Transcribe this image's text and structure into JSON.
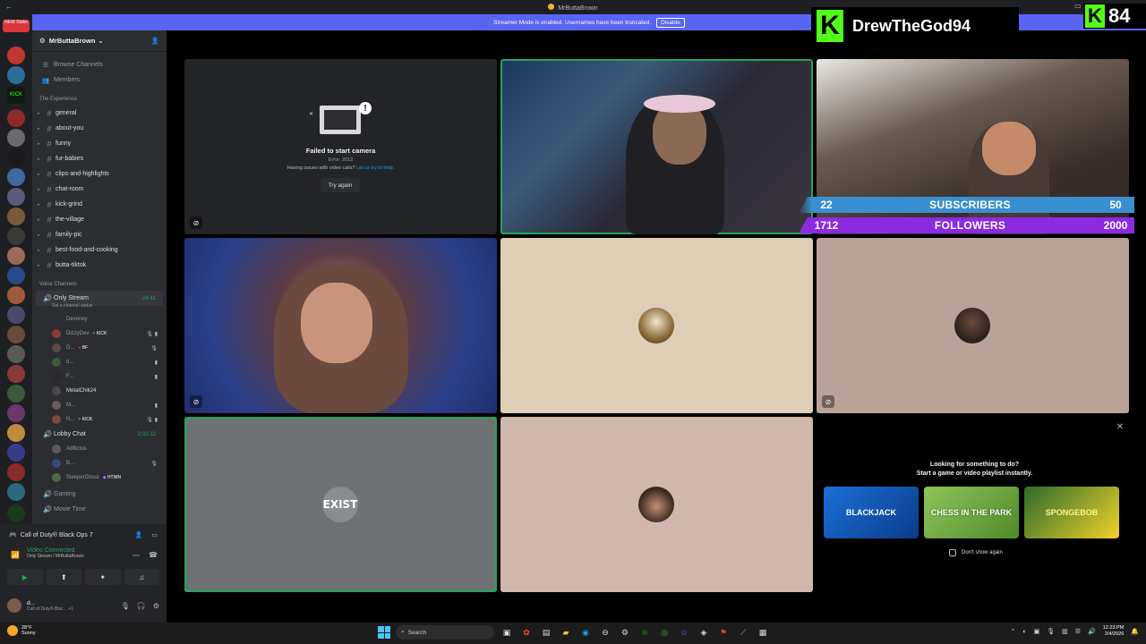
{
  "window": {
    "title": "MrButtaBrown"
  },
  "banner": {
    "text": "Streamer Mode is enabled. Usernames have been truncated.",
    "button": "Disable"
  },
  "rail": {
    "badge": "NEW Stake"
  },
  "server": {
    "name": "MrButtaBrown",
    "nav": [
      "Browse Channels",
      "Members"
    ],
    "category": "The Experience",
    "channels": [
      "general",
      "about-you",
      "funny",
      "fur-babies",
      "clips-and-highlights",
      "chat-room",
      "kick-grind",
      "the-village",
      "family-pic",
      "best-food-and-cooking",
      "butta-tiktok"
    ],
    "voice_category": "Voice Channels",
    "voice": {
      "only_stream": {
        "name": "Only Stream",
        "timer": "24:41",
        "status": "Set a channel status"
      },
      "users": [
        {
          "name": "Deveney",
          "tag": ""
        },
        {
          "name": "DizzyDev",
          "tag": "KICK"
        },
        {
          "name": "D...",
          "tag": "BF"
        },
        {
          "name": "d...",
          "tag": ""
        },
        {
          "name": "F...",
          "tag": ""
        },
        {
          "name": "MetalChik24",
          "tag": ""
        },
        {
          "name": "M...",
          "tag": ""
        },
        {
          "name": "N...",
          "tag": "KICK"
        }
      ],
      "lobby": {
        "name": "Lobby Chat",
        "timer": "2:33:12"
      },
      "lobby_users": [
        {
          "name": "Adflictus",
          "tag": ""
        },
        {
          "name": "B...",
          "tag": ""
        },
        {
          "name": "SleeperGhost",
          "tag": "HTWN"
        }
      ],
      "more": [
        "Gaming",
        "Movie Time"
      ]
    }
  },
  "panel": {
    "activity": "Call of Duty® Black Ops 7",
    "voice_status": "Video Connected",
    "voice_sub": "Only Stream / MrButtaBrown",
    "user_name": "d...",
    "user_status": "Call of Duty® Blac... +1"
  },
  "stage": {
    "camera_error": {
      "title": "Failed to start camera",
      "error": "Error: 2012",
      "help_prefix": "Having issues with video calls?",
      "help_link": "Let us try to help.",
      "retry": "Try again"
    },
    "tile7_label": "EXIST"
  },
  "overlay": {
    "subscribers": {
      "current": "22",
      "label": "SUBSCRIBERS",
      "goal": "50"
    },
    "followers": {
      "current": "1712",
      "label": "FOLLOWERS",
      "goal": "2000"
    },
    "kick_name": "DrewTheGod94",
    "kick_count": "84"
  },
  "suggestion": {
    "line1": "Looking for something to do?",
    "line2": "Start a game or video playlist instantly.",
    "cards": [
      "BLACKJACK",
      "CHESS IN THE PARK",
      "SPONGEBOB"
    ],
    "dont_show": "Don't show again"
  },
  "taskbar": {
    "temp": "28°F",
    "weather": "Sunny",
    "search": "Search",
    "time": "12:23 PM",
    "date": "2/4/2026"
  }
}
